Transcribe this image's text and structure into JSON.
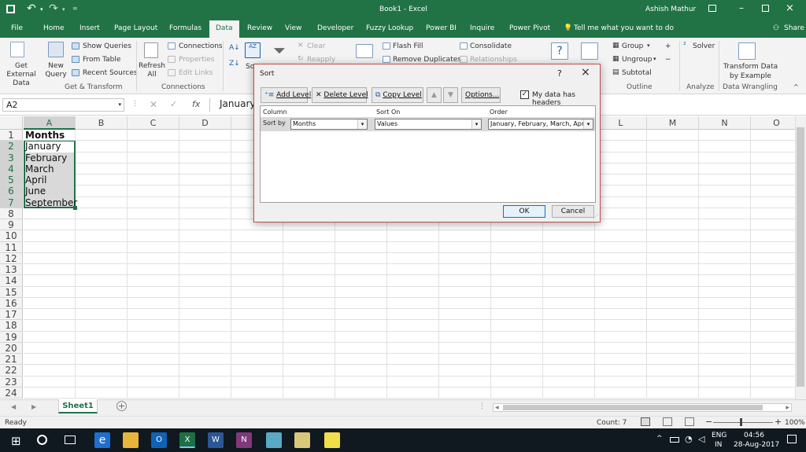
{
  "window": {
    "title": "Book1 - Excel",
    "user": "Ashish Mathur",
    "share_label": "Share"
  },
  "tabs": [
    "File",
    "Home",
    "Insert",
    "Page Layout",
    "Formulas",
    "Data",
    "Review",
    "View",
    "Developer",
    "Fuzzy Lookup",
    "Power BI",
    "Inquire",
    "Power Pivot"
  ],
  "active_tab": "Data",
  "tell_me": "Tell me what you want to do",
  "ribbon": {
    "get_external_data": "Get External Data",
    "new_query": "New Query",
    "show_queries": "Show Queries",
    "from_table": "From Table",
    "recent_sources": "Recent Sources",
    "refresh_all": "Refresh All",
    "connections": "Connections",
    "properties": "Properties",
    "edit_links": "Edit Links",
    "sort_short": "So",
    "clear": "Clear",
    "reapply": "Reapply",
    "flash_fill": "Flash Fill",
    "remove_duplicates": "Remove Duplicates",
    "consolidate": "Consolidate",
    "relationships": "Relationships",
    "group": "Group",
    "ungroup": "Ungroup",
    "subtotal": "Subtotal",
    "solver": "Solver",
    "transform_data": "Transform Data",
    "by_example": "by Example",
    "groups": {
      "get_transform": "Get & Transform",
      "connections": "Connections",
      "outline": "Outline",
      "analyze": "Analyze",
      "data_wrangling": "Data Wrangling"
    }
  },
  "formula_bar": {
    "name_box": "A2",
    "fx": "fx",
    "content": "January"
  },
  "columns": [
    "A",
    "B",
    "C",
    "D",
    "E",
    "F",
    "G",
    "H",
    "I",
    "J",
    "K",
    "L",
    "M",
    "N",
    "O"
  ],
  "rows": [
    "1",
    "2",
    "3",
    "4",
    "5",
    "6",
    "7",
    "8",
    "9",
    "10",
    "11",
    "12",
    "13",
    "14",
    "15",
    "16",
    "17",
    "18",
    "19",
    "20",
    "21",
    "22",
    "23",
    "24"
  ],
  "cells": [
    "Months",
    "January",
    "February",
    "March",
    "April",
    "June",
    "September"
  ],
  "sheet_tab": "Sheet1",
  "status": {
    "ready": "Ready",
    "count": "Count: 7",
    "zoom": "100%"
  },
  "taskbar": {
    "lang_top": "ENG",
    "lang_bottom": "IN",
    "time": "04:56",
    "date": "28-Aug-2017"
  },
  "dialog": {
    "title": "Sort",
    "help": "?",
    "add_level": "Add Level",
    "delete_level": "Delete Level",
    "copy_level": "Copy Level",
    "options": "Options...",
    "headers_checkbox": "My data has headers",
    "headers_checked": true,
    "col_header": "Column",
    "sorton_header": "Sort On",
    "order_header": "Order",
    "sort_by": "Sort by",
    "column_value": "Months",
    "sorton_value": "Values",
    "order_value": "January, February, March, April",
    "ok": "OK",
    "cancel": "Cancel"
  },
  "colors": {
    "excel_green": "#217346",
    "selection_border": "#217346",
    "dialog_border": "#c0504d"
  }
}
